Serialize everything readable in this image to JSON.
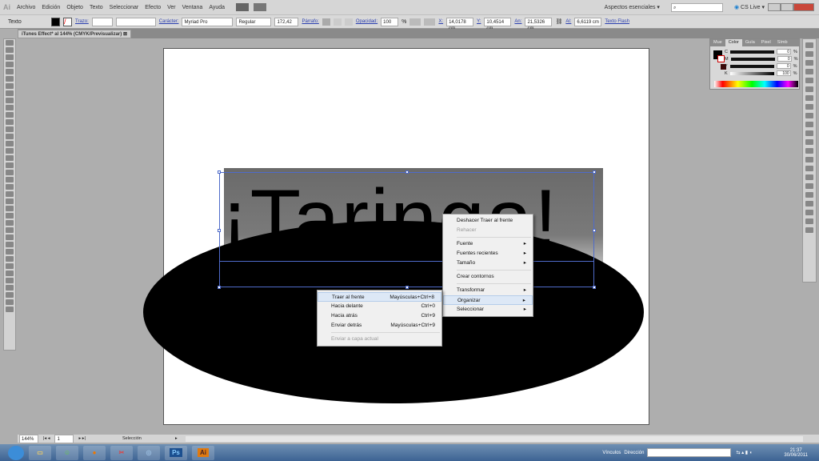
{
  "app": {
    "logo": "Ai"
  },
  "menu": [
    "Archivo",
    "Edición",
    "Objeto",
    "Texto",
    "Seleccionar",
    "Efecto",
    "Ver",
    "Ventana",
    "Ayuda"
  ],
  "workspace": "Aspectos esenciales",
  "cslive": "CS Live",
  "control": {
    "tool": "Texto",
    "trazo": "Trazo:",
    "caracter": "Carácter:",
    "font": "Myriad Pro",
    "style": "Regular",
    "size": "172,42",
    "parrafo": "Párrafo:",
    "opacidad": "Opacidad:",
    "opacity": "100",
    "pct": "%",
    "x_label": "X:",
    "x": "14,0178 cm",
    "y_label": "Y:",
    "y": "10,4514 cm",
    "w_label": "An:",
    "w": "21,5326 cm",
    "h_label": "Al:",
    "h": "6,6119 cm",
    "flash": "Texto Flash"
  },
  "document": {
    "tab": "iTunes Effect* al 144% (CMYK/Previsualizar)",
    "art_text": "¡Taringa!"
  },
  "context_menu": [
    {
      "label": "Deshacer Traer al frente"
    },
    {
      "label": "Rehacer",
      "disabled": true
    },
    {
      "sep": true
    },
    {
      "label": "Fuente",
      "sub": true
    },
    {
      "label": "Fuentes recientes",
      "sub": true
    },
    {
      "label": "Tamaño",
      "sub": true
    },
    {
      "sep": true
    },
    {
      "label": "Crear contornos"
    },
    {
      "sep": true
    },
    {
      "label": "Transformar",
      "sub": true
    },
    {
      "label": "Organizar",
      "sub": true,
      "hl": true
    },
    {
      "label": "Seleccionar",
      "sub": true
    }
  ],
  "submenu": [
    {
      "label": "Traer al frente",
      "sc": "Mayúsculas+Ctrl+8",
      "hl": true
    },
    {
      "label": "Hacia delante",
      "sc": "Ctrl+0"
    },
    {
      "label": "Hacia atrás",
      "sc": "Ctrl+9"
    },
    {
      "label": "Enviar detrás",
      "sc": "Mayúsculas+Ctrl+9"
    },
    {
      "sep": true
    },
    {
      "label": "Enviar a capa actual",
      "sc": "",
      "disabled": true
    }
  ],
  "color_panel": {
    "tabs": [
      "Mue",
      "Color",
      "Guía",
      "Pixel",
      "Símb"
    ],
    "channels": [
      {
        "l": "C",
        "v": "0"
      },
      {
        "l": "M",
        "v": "0"
      },
      {
        "l": "Y",
        "v": "0"
      },
      {
        "l": "K",
        "v": "100"
      }
    ],
    "pct": "%"
  },
  "status": {
    "zoom": "144%",
    "page": "1",
    "tool": "Selección"
  },
  "taskbar": {
    "apps": [
      "Ps",
      "Ai"
    ],
    "vinculos": "Vínculos",
    "direccion": "Dirección",
    "time": "21:37",
    "date": "30/06/2011"
  }
}
